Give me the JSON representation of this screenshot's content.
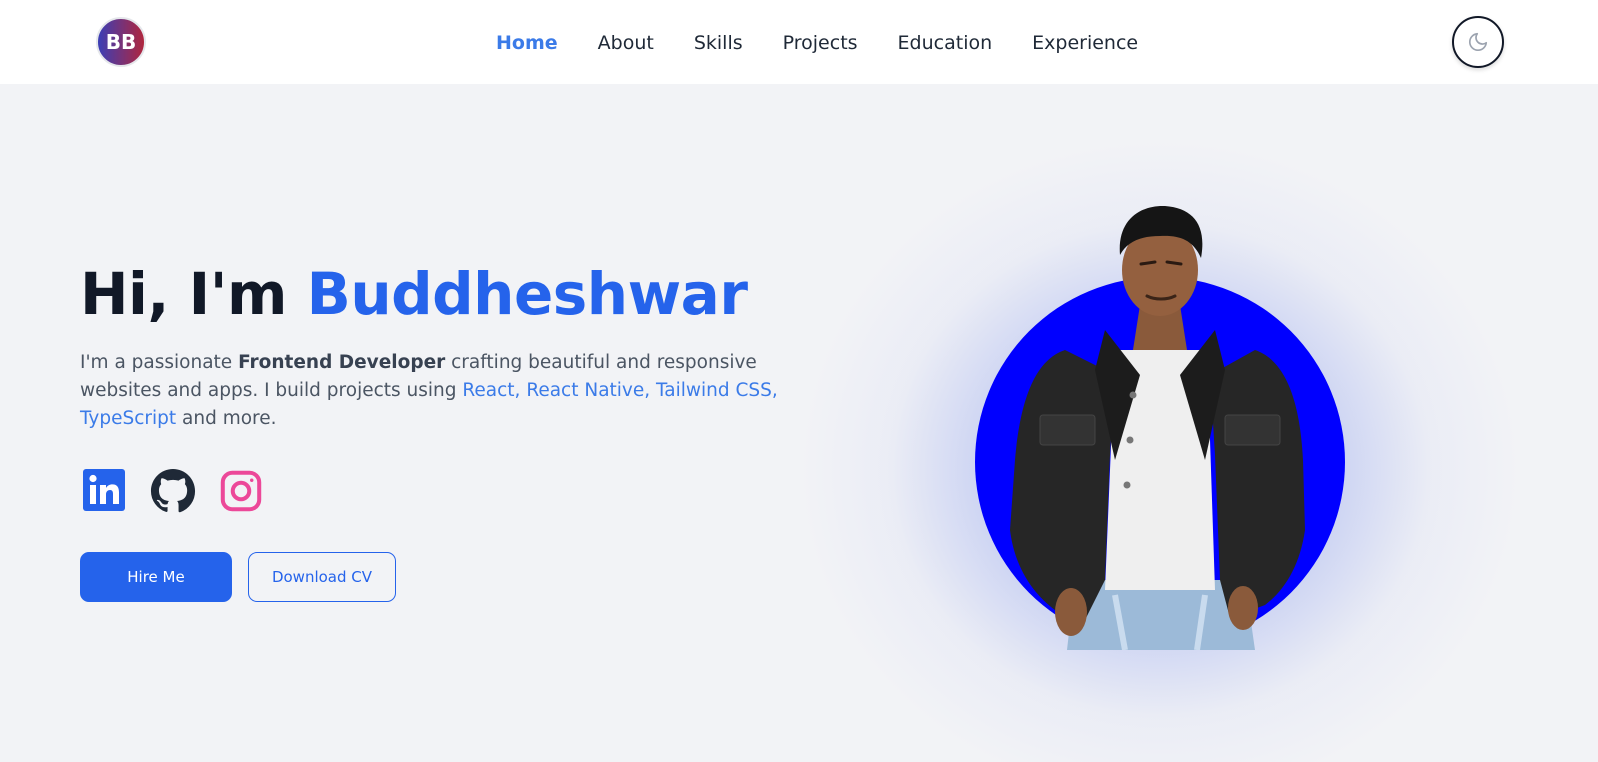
{
  "navbar": {
    "logo_text": "BB",
    "links": [
      {
        "label": "Home",
        "active": true
      },
      {
        "label": "About",
        "active": false
      },
      {
        "label": "Skills",
        "active": false
      },
      {
        "label": "Projects",
        "active": false
      },
      {
        "label": "Education",
        "active": false
      },
      {
        "label": "Experience",
        "active": false
      }
    ],
    "theme_toggle_icon": "moon-icon"
  },
  "hero": {
    "greeting": "Hi, I'm ",
    "name": "Buddheshwar",
    "desc_part1": "I'm a passionate ",
    "desc_role": "Frontend Developer",
    "desc_part2": " crafting beautiful and responsive websites and apps. I build projects using ",
    "desc_tech": "React, React Native, Tailwind CSS, TypeScript",
    "desc_part3": " and more.",
    "socials": [
      {
        "icon": "linkedin-icon",
        "color": "#2563eb"
      },
      {
        "icon": "github-icon",
        "color": "#1f2937"
      },
      {
        "icon": "instagram-icon",
        "color": "#ec4899"
      }
    ],
    "primary_button": "Hire Me",
    "secondary_button": "Download CV"
  },
  "colors": {
    "accent": "#2563eb",
    "portrait_bg": "#0000ff",
    "page_bg": "#f2f3f6"
  }
}
